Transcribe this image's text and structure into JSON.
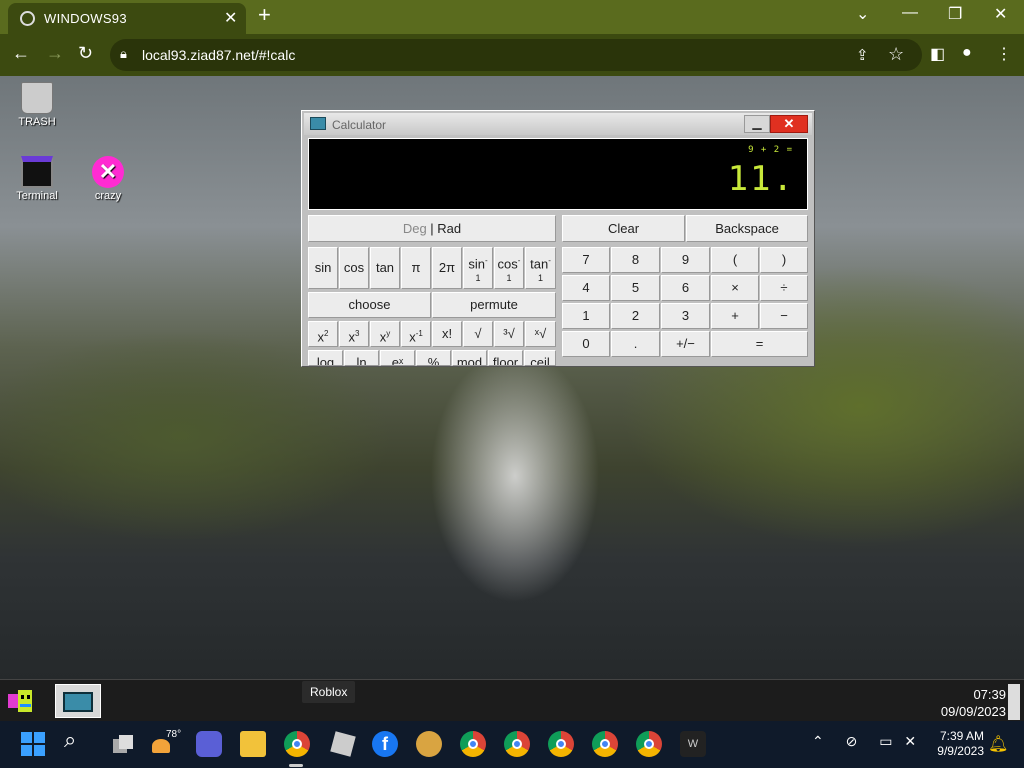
{
  "browser": {
    "tab_title": "WINDOWS93",
    "tab_close": "✕",
    "new_tab": "+",
    "window_controls": [
      "⌄",
      "—",
      "❐",
      "✕"
    ],
    "url": "local93.ziad87.net/#!calc"
  },
  "desktop": {
    "icons": [
      {
        "label": "TRASH"
      },
      {
        "label": "Terminal"
      },
      {
        "label": "crazy"
      }
    ]
  },
  "calculator": {
    "title": "Calculator",
    "minimize": "▁",
    "close": "✕",
    "expression": "9 + 2 =",
    "result": "11.",
    "mode_deg": "Deg",
    "mode_sep": " | ",
    "mode_rad": "Rad",
    "clear": "Clear",
    "backspace": "Backspace",
    "sci_row1": [
      "sin",
      "cos",
      "tan",
      "π",
      "2π"
    ],
    "inverse_trig": [
      {
        "top": "sin",
        "sup": "-",
        "sub": "1"
      },
      {
        "top": "cos",
        "sup": "-",
        "sub": "1"
      },
      {
        "top": "tan",
        "sup": "-",
        "sub": "1"
      }
    ],
    "choose": "choose",
    "permute": "permute",
    "powers": [
      {
        "base": "x",
        "sup": "2"
      },
      {
        "base": "x",
        "sup": "3"
      },
      {
        "base": "x",
        "sup": "y"
      },
      {
        "base": "x",
        "sup": "-1"
      }
    ],
    "factorial": "x!",
    "sqrt": "√",
    "cbrt": "³√",
    "xroot": "ˣ√",
    "sci_row5_partial": [
      "log",
      "ln",
      "eˣ",
      "%",
      "mod",
      "floor",
      "ceil"
    ],
    "numpad": [
      [
        "7",
        "8",
        "9",
        "(",
        ")"
      ],
      [
        "4",
        "5",
        "6",
        "×",
        "÷"
      ],
      [
        "1",
        "2",
        "3",
        "+",
        "−"
      ]
    ],
    "zero": "0",
    "point": ".",
    "negate": "+/−",
    "equals": "="
  },
  "w93_taskbar": {
    "time": "07:39",
    "date": "09/09/2023"
  },
  "tooltip": "Roblox",
  "windows_taskbar": {
    "weather": "78°",
    "facebook": "f",
    "word": "W",
    "time": "7:39 AM",
    "date": "9/9/2023"
  }
}
